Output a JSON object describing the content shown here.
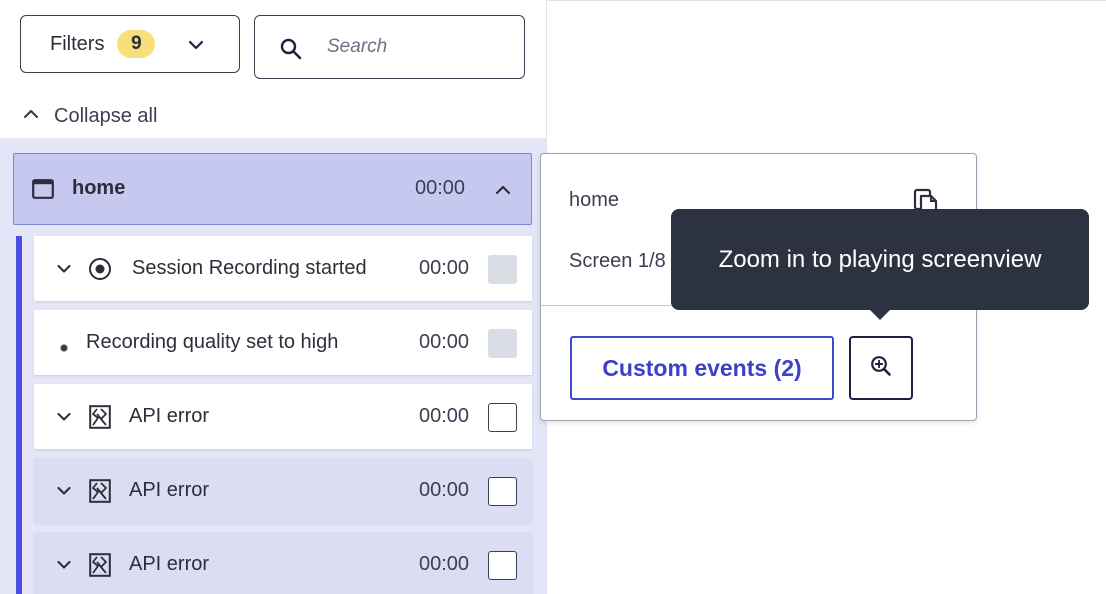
{
  "filters": {
    "label": "Filters",
    "count": "9"
  },
  "search": {
    "placeholder": "Search",
    "value": ""
  },
  "collapse_all": {
    "label": "Collapse all"
  },
  "screen": {
    "name": "home",
    "time": "00:00"
  },
  "events": [
    {
      "label": "Session Recording started",
      "time": "00:00",
      "icon": "record-icon",
      "expandable": true,
      "checkbox": "disabled"
    },
    {
      "label": "Recording quality set to high",
      "time": "00:00",
      "icon": "bullet-icon",
      "expandable": false,
      "checkbox": "disabled"
    },
    {
      "label": "API error",
      "time": "00:00",
      "icon": "api-error-icon",
      "expandable": true,
      "checkbox": "unchecked"
    },
    {
      "label": "API error",
      "time": "00:00",
      "icon": "api-error-icon",
      "expandable": true,
      "checkbox": "unchecked"
    },
    {
      "label": "API error",
      "time": "00:00",
      "icon": "api-error-icon",
      "expandable": true,
      "checkbox": "unchecked"
    }
  ],
  "detail": {
    "title": "home",
    "screen_count": "Screen 1/8",
    "custom_events_label": "Custom events (2)"
  },
  "tooltip": {
    "text": "Zoom in to playing screenview"
  },
  "colors": {
    "accent": "#4346cf",
    "badge": "#f7df7a",
    "list_background": "#e4e5f6",
    "selected_screen": "#c6c8f0",
    "tooltip_background": "#2c323f"
  }
}
